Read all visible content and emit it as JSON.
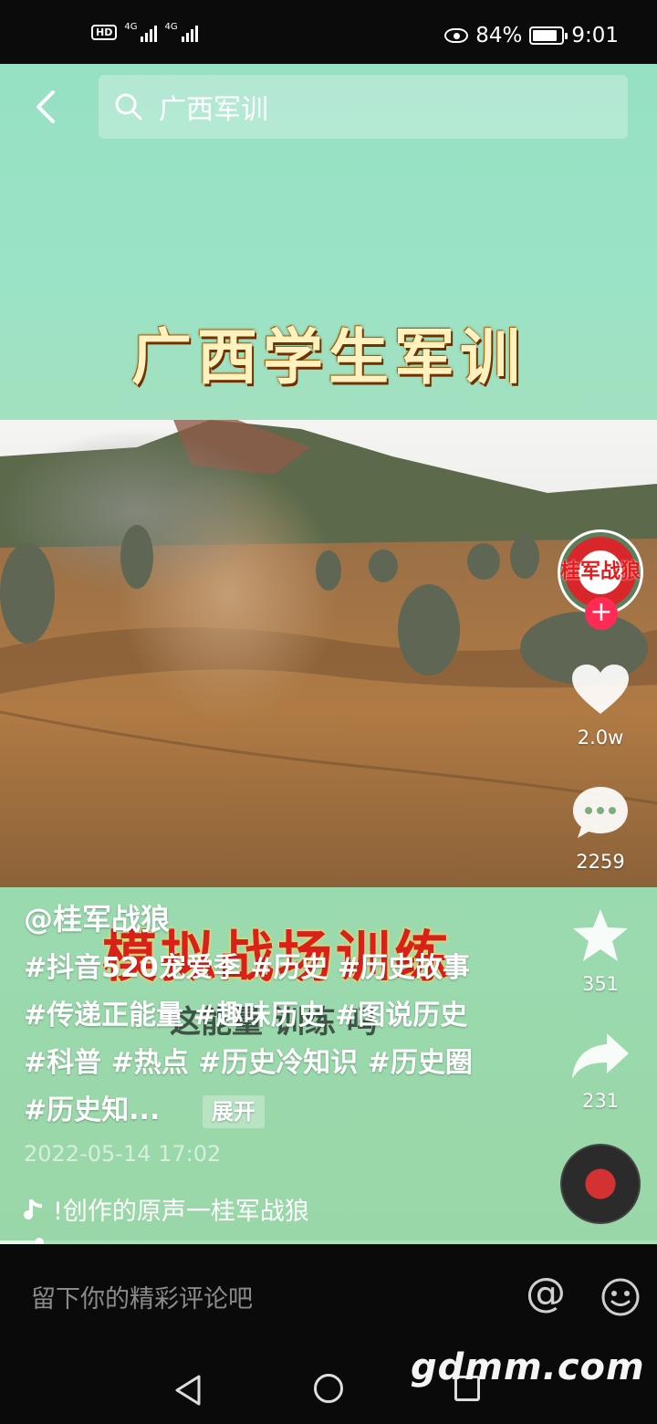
{
  "status_bar": {
    "hd": "HD",
    "sim1": "4G",
    "sim2": "4G",
    "battery_percent": "84%",
    "battery_level": 0.84,
    "time": "9:01"
  },
  "search": {
    "query": "广西军训"
  },
  "video": {
    "title_overlay": "广西学生军训",
    "sub_overlay": "模拟战场训练",
    "sub_overlay_2": "这能量 训练 吗",
    "watermark_in_video": "桂军战狼"
  },
  "author": {
    "handle": "@桂军战狼",
    "avatar_text": "桂军战狼"
  },
  "actions": {
    "likes": "2.0w",
    "comments": "2259",
    "favorites": "351",
    "shares": "231"
  },
  "caption": {
    "text": "#抖音520宠爱季 #历史 #历史故事 #传递正能量 #趣味历史 #图说历史 #科普 #热点 #历史冷知识 #历史圈 #历史知...",
    "expand_label": "展开",
    "date": "2022-05-14 17:02"
  },
  "music": {
    "title": "!创作的原声一桂军战狼"
  },
  "progress": 0.06,
  "comment_bar": {
    "placeholder": "留下你的精彩评论吧"
  },
  "site_watermark": "gdmm.com"
}
